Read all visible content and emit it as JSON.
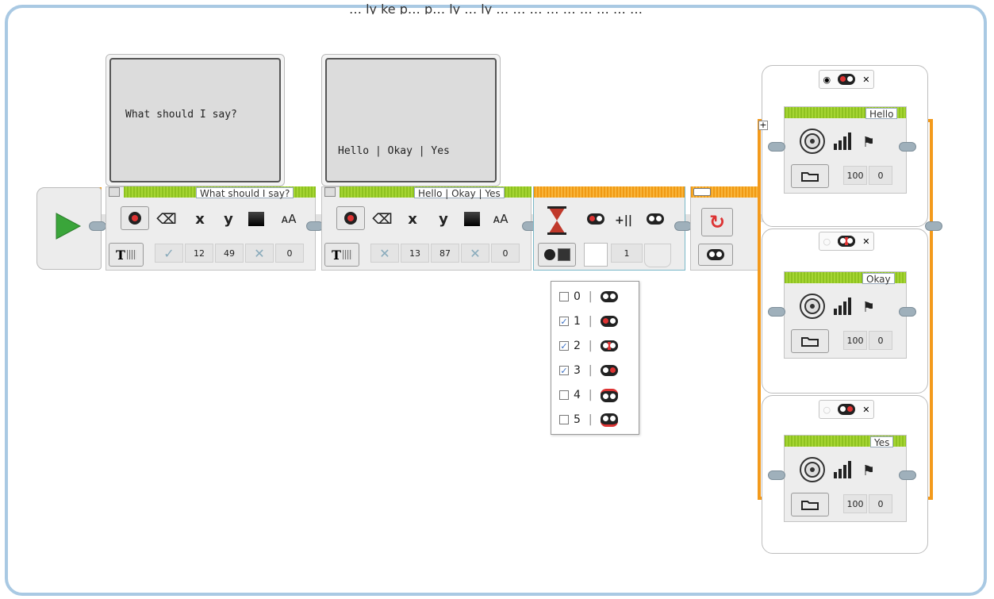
{
  "caption_fragment": "… ly ke p… p… ly … ly … … … … … … … … …",
  "display_block_1": {
    "preview_text": "What should I say?",
    "label": "What should I say?",
    "params": [
      "12",
      "49",
      "0"
    ]
  },
  "display_block_2": {
    "preview_text": "Hello | Okay | Yes",
    "label": "Hello | Okay | Yes",
    "params": [
      "13",
      "87",
      "0"
    ]
  },
  "wait_block": {
    "param_value": "1"
  },
  "brick_buttons_dropdown": {
    "options": [
      {
        "value": "0",
        "checked": false
      },
      {
        "value": "1",
        "checked": true
      },
      {
        "value": "2",
        "checked": true
      },
      {
        "value": "3",
        "checked": true
      },
      {
        "value": "4",
        "checked": false
      },
      {
        "value": "5",
        "checked": false
      }
    ]
  },
  "switch_cases": [
    {
      "label": "Hello",
      "volume": "100",
      "play_type": "0"
    },
    {
      "label": "Okay",
      "volume": "100",
      "play_type": "0"
    },
    {
      "label": "Yes",
      "volume": "100",
      "play_type": "0"
    }
  ],
  "colors": {
    "accent_green": "#8ec220",
    "accent_orange": "#f39a1c",
    "frame_blue": "#a9c9e3",
    "start_arrow": "#3aa53a"
  },
  "icons": [
    "start-arrow-icon",
    "brick-display-icon",
    "eraser-icon",
    "x-coord-icon",
    "y-coord-icon",
    "color-icon",
    "font-size-icon",
    "text-grid-icon",
    "check-icon",
    "cross-icon",
    "hourglass-icon",
    "brick-buttons-icon",
    "compare-icon",
    "loop-icon",
    "speaker-icon",
    "volume-icon",
    "flag-icon",
    "folder-icon"
  ]
}
